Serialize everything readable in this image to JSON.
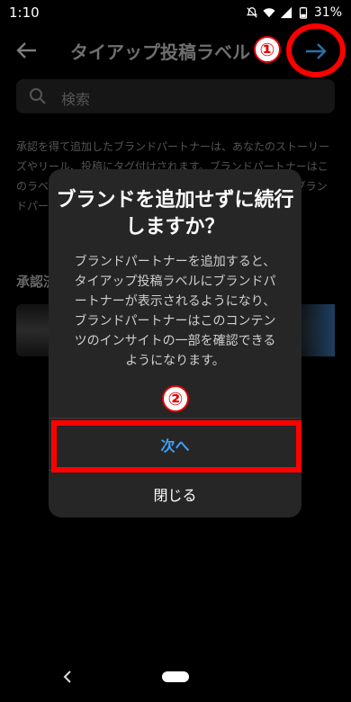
{
  "status_bar": {
    "time": "1:10",
    "battery": "31%",
    "icons": [
      "mute-icon",
      "wifi-icon",
      "signal-icon",
      "battery-icon"
    ]
  },
  "header": {
    "title": "タイアップ投稿ラベル",
    "back_icon": "arrow-left-icon",
    "next_icon": "arrow-right-icon"
  },
  "search": {
    "placeholder": "検索"
  },
  "description": "承認を得て追加したブランドパートナーは、あなたのストーリーズやリール、投稿にタグ付けされます。ブランドパートナーはこのラベルを確認できます。ブランドパートナーは…ます。ブランドパートナーが表示されるようになり…ーに従う必要…",
  "section": {
    "title": "承認済"
  },
  "dialog": {
    "title": "ブランドを追加せずに続行しますか？",
    "body": "ブランドパートナーを追加すると、タイアップ投稿ラベルにブランドパートナーが表示されるようになり、ブランドパートナーはこのコンテンツのインサイトの一部を確認できるようになります。",
    "next_label": "次へ",
    "close_label": "閉じる"
  },
  "annotations": {
    "num1": "①",
    "num2": "②",
    "highlight_color": "#ff0000"
  },
  "colors": {
    "accent": "#3ea0f5",
    "dialog_bg": "#262626"
  }
}
